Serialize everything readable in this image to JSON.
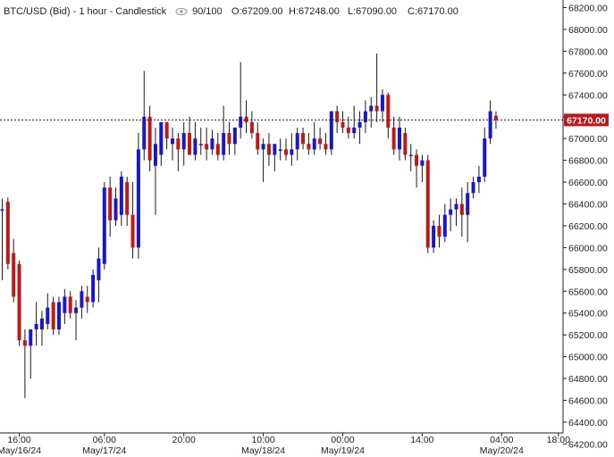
{
  "header": {
    "symbol": "BTC/USD (Bid) - 1 hour - Candlestick",
    "eye_icon": "eye-icon",
    "bars": "90/100",
    "open": "O:67209.00",
    "high": "H:67248.00",
    "low": "L:67090.00",
    "close": "C:67170.00"
  },
  "colors": {
    "bull": "#1a17c8",
    "bear": "#c01717",
    "wick": "#1a1a1a",
    "label_bg": "#c01717",
    "axis": "#222222",
    "crosshair": "#222222"
  },
  "chart_data": {
    "type": "candlestick",
    "title": "BTC/USD (Bid) - 1 hour - Candlestick",
    "ylim": [
      64200,
      68300
    ],
    "y_ticks": [
      64200,
      64400,
      64600,
      64800,
      65000,
      65200,
      65400,
      65600,
      65800,
      66000,
      66200,
      66400,
      66600,
      66800,
      67000,
      67200,
      67400,
      67600,
      67800,
      68000,
      68200
    ],
    "y_tick_labels": [
      "64200.00",
      "64400.00",
      "64600.00",
      "64800.00",
      "65000.00",
      "65200.00",
      "65400.00",
      "65600.00",
      "65800.00",
      "66000.00",
      "66200.00",
      "66400.00",
      "66600.00",
      "66800.00",
      "67000.00",
      "67200.00",
      "67400.00",
      "67600.00",
      "67800.00",
      "68000.00",
      "68200.00"
    ],
    "x_ticks": [
      {
        "bar": 3,
        "time": "16:00",
        "date": "May/16/24"
      },
      {
        "bar": 18,
        "time": "06:00",
        "date": "May/17/24"
      },
      {
        "bar": 32,
        "time": "20:00"
      },
      {
        "bar": 46,
        "time": "10:00",
        "date": "May/18/24"
      },
      {
        "bar": 60,
        "time": "00:00",
        "date": "May/19/24"
      },
      {
        "bar": 74,
        "time": "14:00"
      },
      {
        "bar": 88,
        "time": "04:00",
        "date": "May/20/24"
      },
      {
        "bar": 98,
        "time": "18:00"
      }
    ],
    "current_price": 67170.0,
    "current_price_label": "67170.00",
    "ohlc": [
      [
        66350,
        66450,
        65700,
        66350
      ],
      [
        66420,
        66460,
        65800,
        65850
      ],
      [
        65950,
        66080,
        65500,
        65550
      ],
      [
        65850,
        65880,
        65100,
        65150
      ],
      [
        65150,
        65250,
        64620,
        65100
      ],
      [
        65100,
        65220,
        64800,
        65250
      ],
      [
        65250,
        65500,
        65100,
        65300
      ],
      [
        65250,
        65420,
        65100,
        65350
      ],
      [
        65300,
        65580,
        65250,
        65450
      ],
      [
        65500,
        65550,
        65200,
        65250
      ],
      [
        65250,
        65550,
        65200,
        65500
      ],
      [
        65400,
        65620,
        65300,
        65550
      ],
      [
        65550,
        65600,
        65350,
        65400
      ],
      [
        65400,
        65520,
        65150,
        65450
      ],
      [
        65450,
        65650,
        65350,
        65600
      ],
      [
        65550,
        65650,
        65400,
        65500
      ],
      [
        65500,
        65800,
        65450,
        65750
      ],
      [
        65700,
        66000,
        65500,
        65900
      ],
      [
        65850,
        66600,
        65800,
        66550
      ],
      [
        66550,
        66650,
        66100,
        66250
      ],
      [
        66250,
        66550,
        66200,
        66450
      ],
      [
        66300,
        66700,
        66200,
        66650
      ],
      [
        66600,
        66650,
        66200,
        66300
      ],
      [
        66300,
        66600,
        65900,
        66000
      ],
      [
        66000,
        67050,
        65900,
        66900
      ],
      [
        66900,
        67620,
        66800,
        67200
      ],
      [
        67200,
        67300,
        66700,
        66800
      ],
      [
        66750,
        67100,
        66300,
        66950
      ],
      [
        66850,
        67100,
        66750,
        67150
      ],
      [
        67150,
        67150,
        66900,
        67000
      ],
      [
        66950,
        67100,
        66800,
        67000
      ],
      [
        67000,
        67050,
        66700,
        66900
      ],
      [
        66900,
        67150,
        66750,
        67050
      ],
      [
        67050,
        67200,
        66900,
        66850
      ],
      [
        66850,
        67150,
        66800,
        67000
      ],
      [
        66950,
        67100,
        66850,
        66950
      ],
      [
        66950,
        67100,
        66800,
        66900
      ],
      [
        66900,
        67080,
        66850,
        67000
      ],
      [
        66950,
        67050,
        66800,
        66850
      ],
      [
        66850,
        67300,
        66800,
        67050
      ],
      [
        67050,
        67150,
        66850,
        66950
      ],
      [
        66950,
        67100,
        66850,
        67100
      ],
      [
        67100,
        67700,
        67000,
        67200
      ],
      [
        67200,
        67350,
        67050,
        67150
      ],
      [
        67150,
        67250,
        67000,
        67050
      ],
      [
        67050,
        67150,
        66850,
        66900
      ],
      [
        66900,
        67000,
        66600,
        66950
      ],
      [
        66950,
        67050,
        66750,
        66850
      ],
      [
        66850,
        66950,
        66700,
        66950
      ],
      [
        66900,
        67000,
        66800,
        66900
      ],
      [
        66900,
        67000,
        66800,
        66850
      ],
      [
        66850,
        67050,
        66750,
        66900
      ],
      [
        66900,
        67100,
        66800,
        67050
      ],
      [
        67050,
        67100,
        66900,
        66950
      ],
      [
        66950,
        67050,
        66850,
        66900
      ],
      [
        66900,
        67150,
        66850,
        67000
      ],
      [
        67000,
        67100,
        66900,
        66950
      ],
      [
        66950,
        67050,
        66850,
        66900
      ],
      [
        66900,
        67250,
        66850,
        67250
      ],
      [
        67250,
        67300,
        67050,
        67150
      ],
      [
        67150,
        67250,
        67050,
        67100
      ],
      [
        67100,
        67200,
        67000,
        67050
      ],
      [
        67050,
        67300,
        67000,
        67100
      ],
      [
        67100,
        67250,
        66950,
        67150
      ],
      [
        67150,
        67350,
        67050,
        67250
      ],
      [
        67250,
        67380,
        67100,
        67300
      ],
      [
        67300,
        67780,
        67150,
        67250
      ],
      [
        67250,
        67450,
        67150,
        67400
      ],
      [
        67400,
        67420,
        67000,
        67100
      ],
      [
        67100,
        67200,
        66850,
        66900
      ],
      [
        66900,
        67200,
        66800,
        67100
      ],
      [
        67050,
        67100,
        66800,
        66850
      ],
      [
        66850,
        66950,
        66700,
        66850
      ],
      [
        66850,
        66900,
        66550,
        66750
      ],
      [
        66750,
        66850,
        66600,
        66800
      ],
      [
        66800,
        66850,
        65950,
        66000
      ],
      [
        66000,
        66250,
        65950,
        66200
      ],
      [
        66200,
        66300,
        66000,
        66100
      ],
      [
        66100,
        66400,
        66050,
        66300
      ],
      [
        66300,
        66450,
        66150,
        66350
      ],
      [
        66350,
        66450,
        66200,
        66400
      ],
      [
        66400,
        66550,
        66100,
        66300
      ],
      [
        66300,
        66600,
        66050,
        66500
      ],
      [
        66500,
        66650,
        66450,
        66600
      ],
      [
        66600,
        66750,
        66500,
        66650
      ],
      [
        66650,
        67100,
        66600,
        67000
      ],
      [
        67000,
        67350,
        66950,
        67250
      ],
      [
        67209,
        67248,
        67090,
        67170
      ]
    ]
  }
}
